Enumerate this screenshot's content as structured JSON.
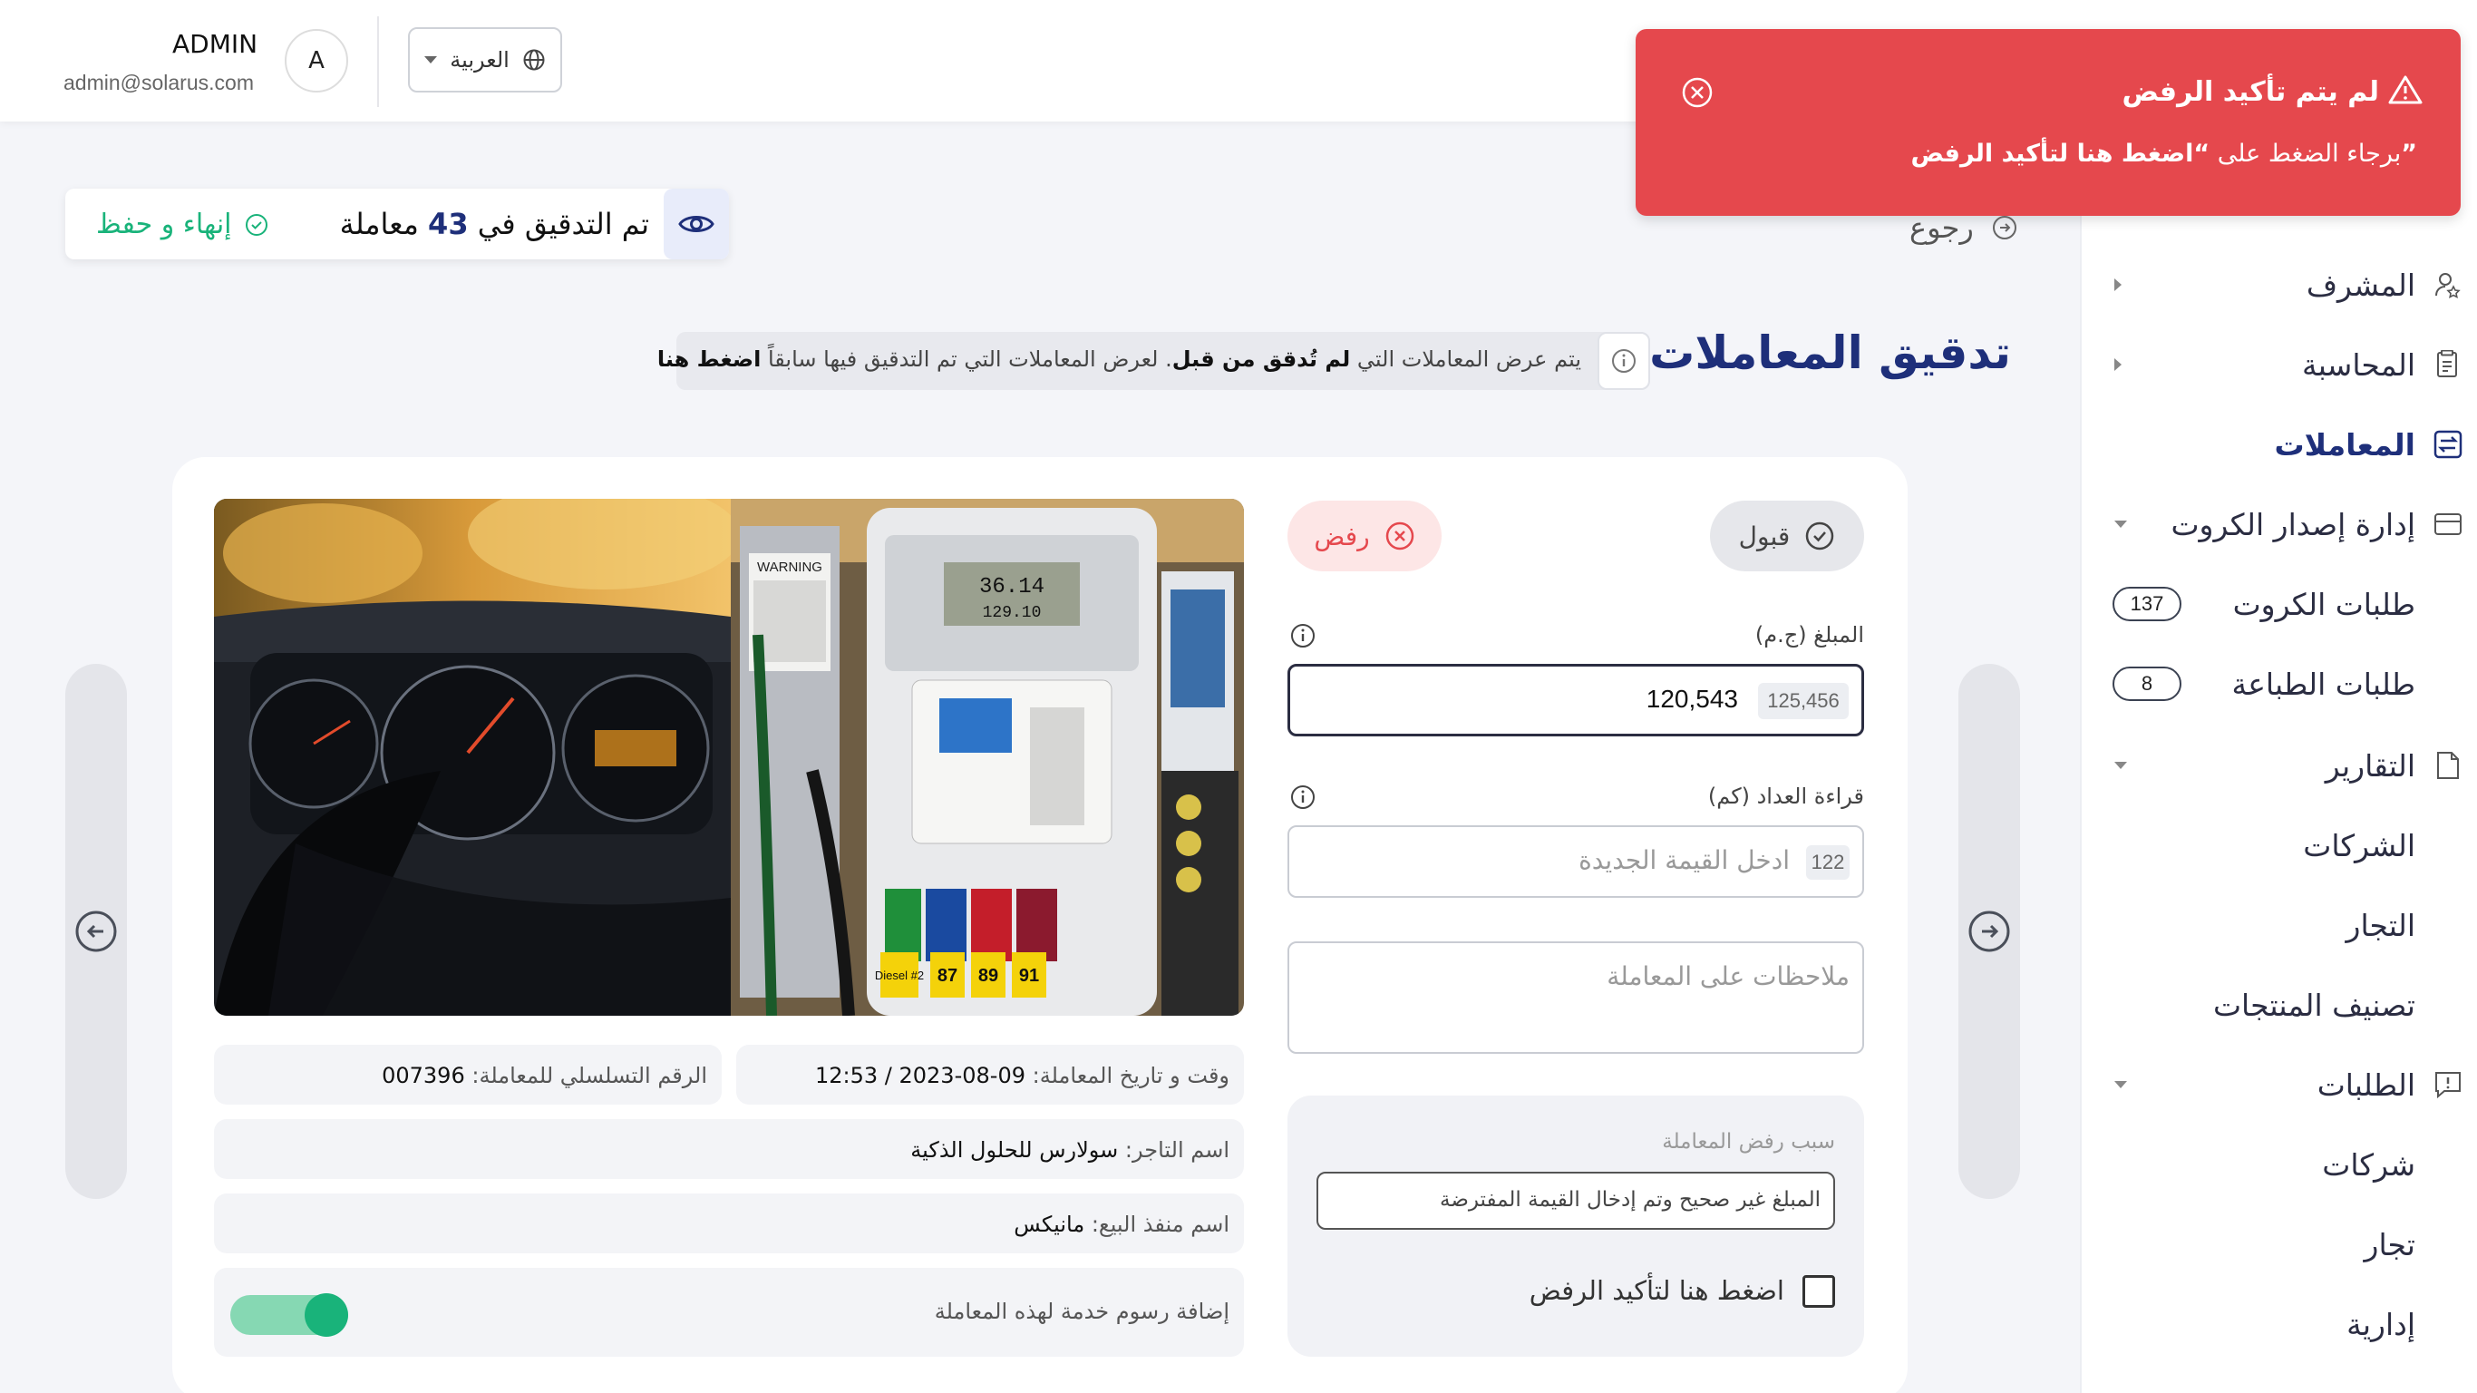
{
  "topbar": {
    "user_name": "ADMIN",
    "user_email": "admin@solarus.com",
    "avatar_letter": "A",
    "language": "العربية"
  },
  "toast": {
    "title": "لم يتم تأكيد الرفض",
    "message_prefix": "برجاء الضغط على ",
    "message_link": "“اضغط هنا لتأكيد الرفض”",
    "color": "#e5484d"
  },
  "sidebar": {
    "items": [
      {
        "label": "المشرف",
        "icon": "supervisor-icon"
      },
      {
        "label": "المحاسبة",
        "icon": "accounting-icon"
      },
      {
        "label": "المعاملات",
        "icon": "transactions-icon"
      },
      {
        "label": "إدارة إصدار الكروت",
        "icon": "cards-icon"
      },
      {
        "label": "طلبات الكروت",
        "badge": "137"
      },
      {
        "label": "طلبات الطباعة",
        "badge": "8"
      },
      {
        "label": "التقارير",
        "icon": "reports-icon"
      },
      {
        "label": "الشركات"
      },
      {
        "label": "التجار"
      },
      {
        "label": "تصنيف المنتجات"
      },
      {
        "label": "الطلبات",
        "icon": "requests-icon"
      },
      {
        "label": "شركات"
      },
      {
        "label": "تجار"
      },
      {
        "label": "إدارية"
      }
    ]
  },
  "header": {
    "back": "رجوع",
    "verify_prefix": "تم التدقيق في",
    "verify_count": "43",
    "verify_suffix": "معاملة",
    "finish": "إنهاء و حفظ",
    "page_title": "تدقيق المعاملات",
    "info_part1": "يتم عرض المعاملات التي",
    "info_bold": "لم تُدقق من قبل",
    "info_part2": ". لعرض المعاملات التي تم التدقيق فيها سابقاً",
    "info_link": "اضغط هنا"
  },
  "form": {
    "accept": "قبول",
    "reject": "رفض",
    "amount_label": "المبلغ (ج.م)",
    "amount_value": "120,543",
    "amount_original": "125,456",
    "odometer_label": "قراءة العداد (كم)",
    "odometer_placeholder": "ادخل القيمة الجديدة",
    "odometer_original": "122",
    "notes_placeholder": "ملاحظات على المعاملة",
    "reject_reason_label": "سبب رفض المعاملة",
    "reject_reason_value": "المبلغ غير صحيح وتم إدخال القيمة المفترضة",
    "confirm_reject": "اضغط هنا لتأكيد الرفض"
  },
  "details": {
    "datetime_label": "وقت و تاريخ المعاملة:",
    "datetime_value": "09-08-2023  /  12:53",
    "serial_label": "الرقم التسلسلي للمعاملة:",
    "serial_value": "007396",
    "merchant_label": "اسم التاجر:",
    "merchant_value": "سولارس للحلول الذكية",
    "outlet_label": "اسم منفذ البيع:",
    "outlet_value": "مانيكس",
    "fee_label": "إضافة رسوم خدمة لهذه المعاملة",
    "fee_enabled": true
  },
  "photo": {
    "warning": "WARNING",
    "display_top": "36.14",
    "display_bottom": "129.10",
    "grades": [
      "87",
      "89",
      "91"
    ],
    "diesel": "Diesel #2"
  }
}
